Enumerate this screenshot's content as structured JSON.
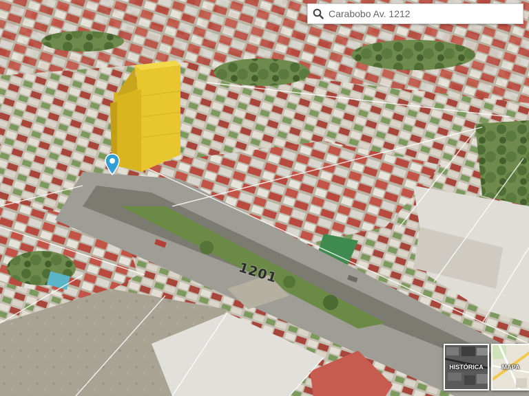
{
  "search": {
    "value": "Carabobo Av. 1212",
    "icon": "search-icon"
  },
  "map": {
    "street_number_label": "1201",
    "building_color": "#e3c12a",
    "marker_color": "#2f9fd6"
  },
  "layer_switcher": {
    "historica_label": "HISTÓRICA",
    "mapa_label": "MAPA"
  }
}
